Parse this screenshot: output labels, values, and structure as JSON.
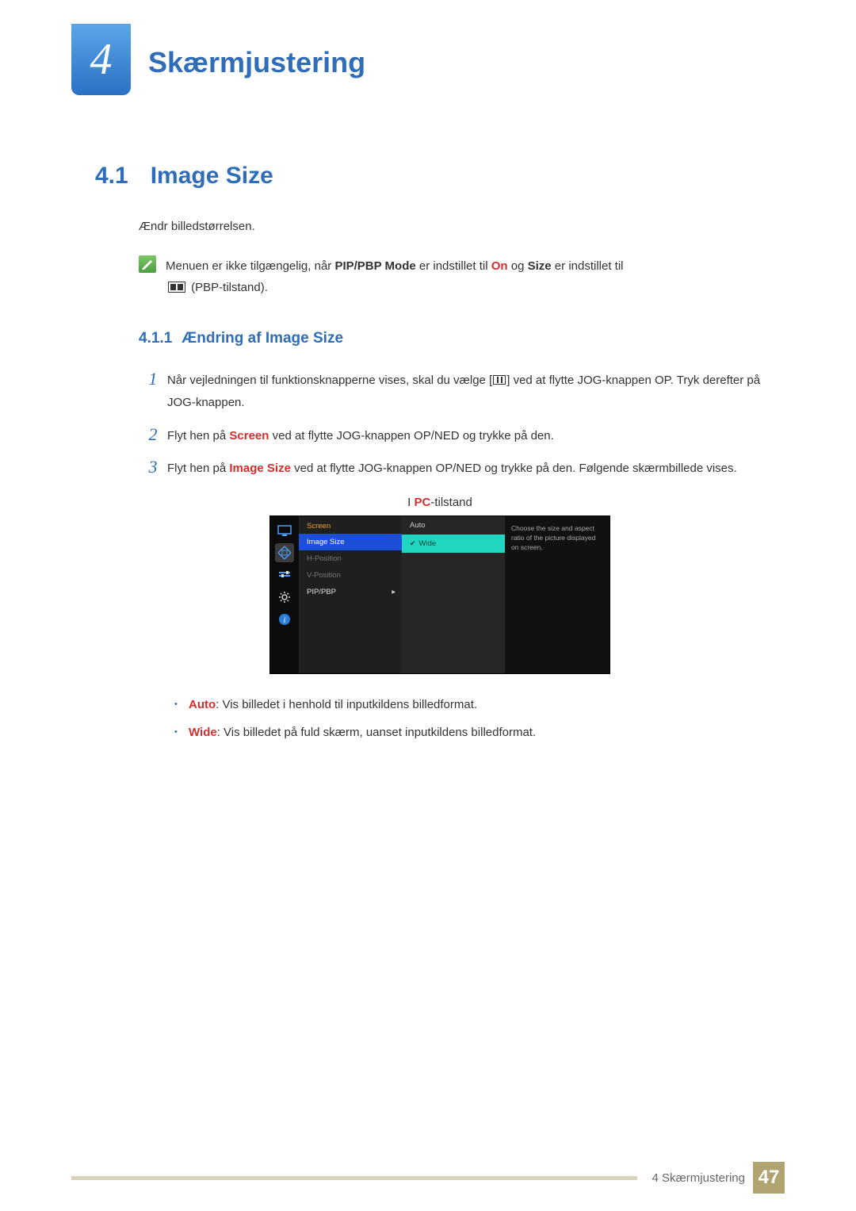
{
  "chapter": {
    "number": "4",
    "title": "Skærmjustering"
  },
  "section": {
    "number": "4.1",
    "title": "Image Size",
    "intro": "Ændr billedstørrelsen.",
    "note": {
      "pre": "Menuen er ikke tilgængelig, når ",
      "pipLabel": "PIP/PBP Mode",
      "mid1": " er indstillet til ",
      "on": "On",
      "mid2": " og ",
      "sizeLabel": "Size",
      "mid3": " er indstillet til ",
      "pbpSuffix": " (PBP-tilstand)."
    }
  },
  "subsection": {
    "number": "4.1.1",
    "title": "Ændring af Image Size"
  },
  "steps": {
    "s1a": "Når vejledningen til funktionsknapperne vises, skal du vælge [",
    "s1b": "] ved at flytte JOG-knappen OP. Tryk derefter på JOG-knappen.",
    "s2a": "Flyt hen på ",
    "s2hl": "Screen",
    "s2b": " ved at flytte JOG-knappen OP/NED og trykke på den.",
    "s3a": "Flyt hen på ",
    "s3hl": "Image Size",
    "s3b": " ved at flytte JOG-knappen OP/NED og trykke på den. Følgende skærmbillede vises."
  },
  "osd": {
    "captionPre": "I ",
    "captionHl": "PC",
    "captionPost": "-tilstand",
    "header": "Screen",
    "menu": {
      "imageSize": "Image Size",
      "hpos": "H-Position",
      "vpos": "V-Position",
      "pip": "PIP/PBP"
    },
    "options": {
      "auto": "Auto",
      "wide": "Wide"
    },
    "desc": "Choose the size and aspect ratio of the picture displayed on screen."
  },
  "bullets": {
    "b1hl": "Auto",
    "b1": ": Vis billedet i henhold til inputkildens billedformat.",
    "b2hl": "Wide",
    "b2": ": Vis billedet på fuld skærm, uanset inputkildens billedformat."
  },
  "footer": {
    "chapterLabel": "4 Skærmjustering",
    "page": "47"
  }
}
